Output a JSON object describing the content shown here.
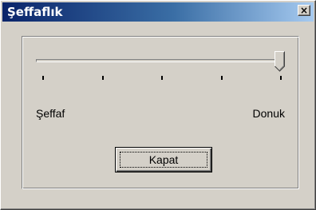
{
  "window": {
    "title": "Şeffaflık"
  },
  "slider": {
    "value": 1.0,
    "tick_count": 5,
    "min_label": "Şeffaf",
    "max_label": "Donuk"
  },
  "buttons": {
    "close_label": "Kapat",
    "titlebar_close_glyph": "×"
  },
  "icons": {
    "titlebar_close": "close-icon",
    "slider_thumb": "slider-thumb-pointer"
  },
  "colors": {
    "face": "#d4d0c8",
    "title_gradient_start": "#0a246a",
    "title_gradient_end": "#a6caf0",
    "title_text": "#ffffff"
  }
}
